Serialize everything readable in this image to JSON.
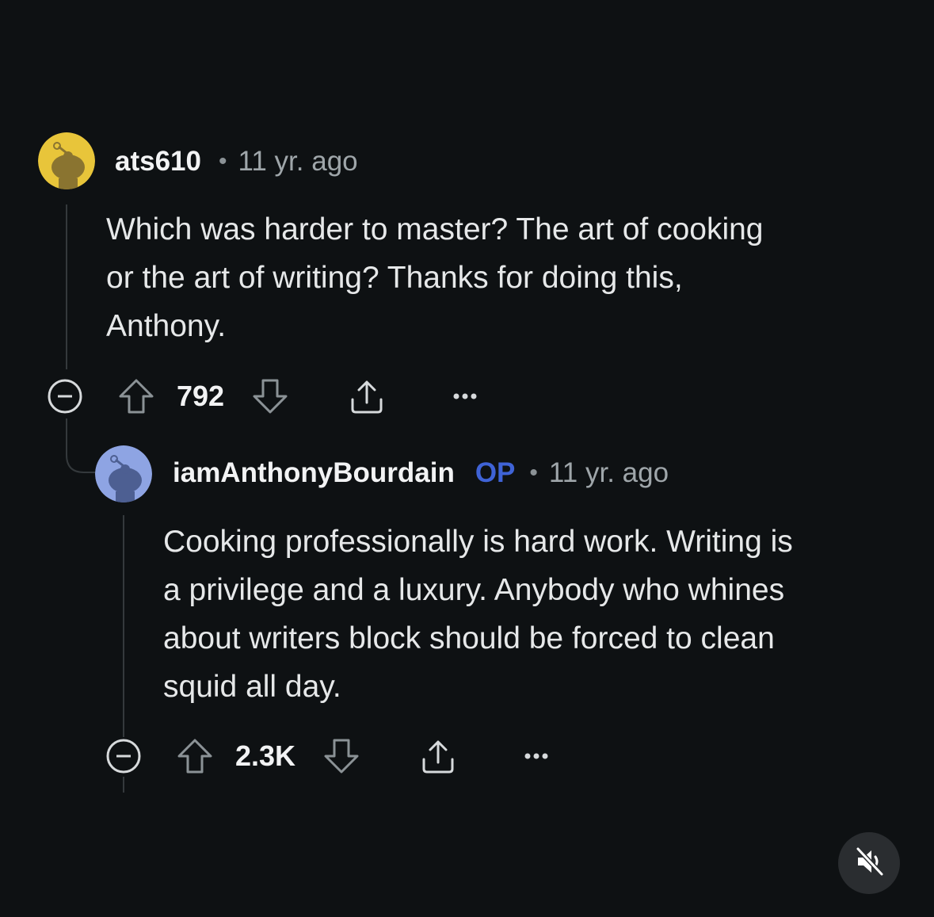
{
  "comments": [
    {
      "username": "ats610",
      "separator": "•",
      "time": "11 yr. ago",
      "body_lines": [
        "Which was harder to master? The art of cooking",
        "or the art of writing? Thanks for doing this,",
        "Anthony."
      ],
      "score": "792",
      "avatar_color": "#e8c53a"
    },
    {
      "username": "iamAnthonyBourdain",
      "badge": "OP",
      "separator": "•",
      "time": "11 yr. ago",
      "body_lines": [
        "Cooking professionally is hard work. Writing is",
        "a privilege and a luxury. Anybody who whines",
        "about writers block should be forced to clean",
        "squid all day."
      ],
      "score": "2.3K",
      "avatar_color": "#8ea4e3"
    }
  ],
  "icons": {
    "collapse": "collapse-icon",
    "upvote": "upvote-icon",
    "downvote": "downvote-icon",
    "share": "share-icon",
    "more": "more-icon",
    "mute": "mute-icon"
  },
  "colors": {
    "background": "#0e1113",
    "op_badge": "#3f63d6"
  }
}
